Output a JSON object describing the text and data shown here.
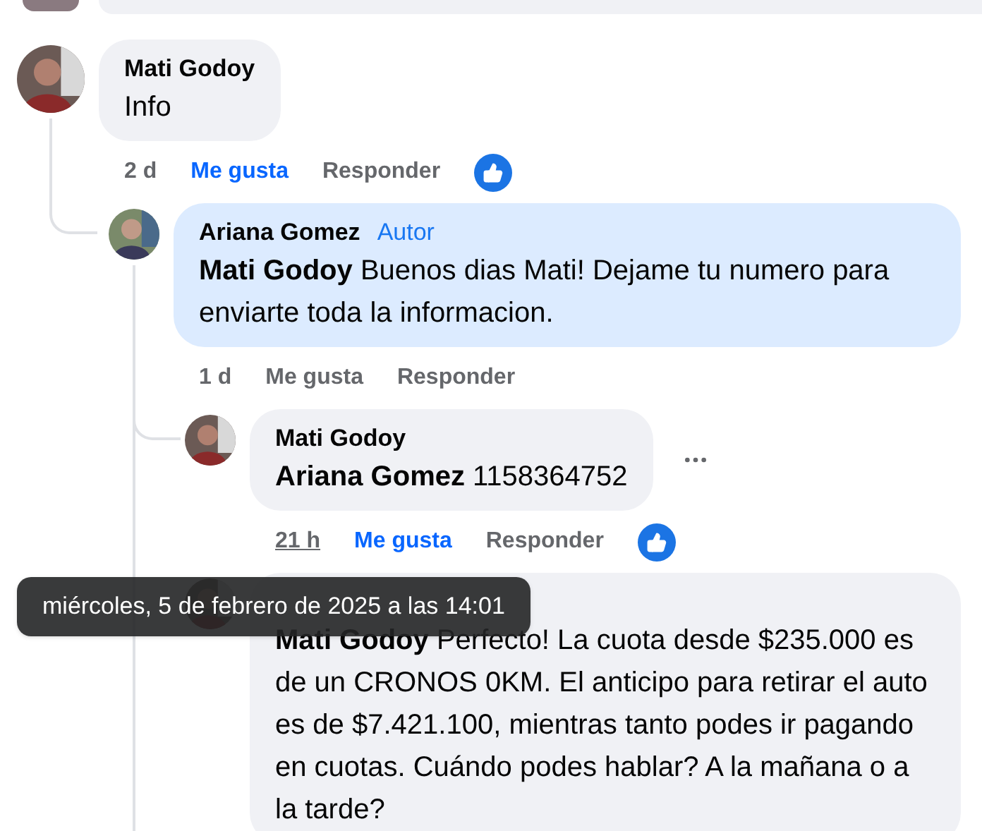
{
  "comments": [
    {
      "author": "Mati Godoy",
      "text": "Info",
      "time": "2 d",
      "like_label": "Me gusta",
      "liked": true,
      "reply_label": "Responder",
      "reaction": true,
      "children": [
        {
          "author": "Ariana Gomez",
          "badge": "Autor",
          "highlighted": true,
          "mention": "Mati Godoy",
          "text": "Buenos dias Mati! Dejame tu numero para enviarte toda la informacion.",
          "time": "1 d",
          "like_label": "Me gusta",
          "liked": false,
          "reply_label": "Responder",
          "reaction": false,
          "children": [
            {
              "author": "Mati Godoy",
              "mention": "Ariana Gomez",
              "text": "1158364752",
              "time": "21 h",
              "time_hovered": true,
              "like_label": "Me gusta",
              "liked": true,
              "reply_label": "Responder",
              "reaction": true,
              "menu": true
            },
            {
              "mention": "Mati Godoy",
              "text": "Perfecto! La cuota desde $235.000 es de un CRONOS 0KM. El anticipo para retirar el auto es de $7.421.100, mientras tanto podes ir pagando en cuotas. Cuándo podes hablar? A la mañana o a la tarde?"
            }
          ]
        }
      ]
    }
  ],
  "tooltip": {
    "text": "miércoles, 5 de febrero de 2025 a las 14:01"
  }
}
